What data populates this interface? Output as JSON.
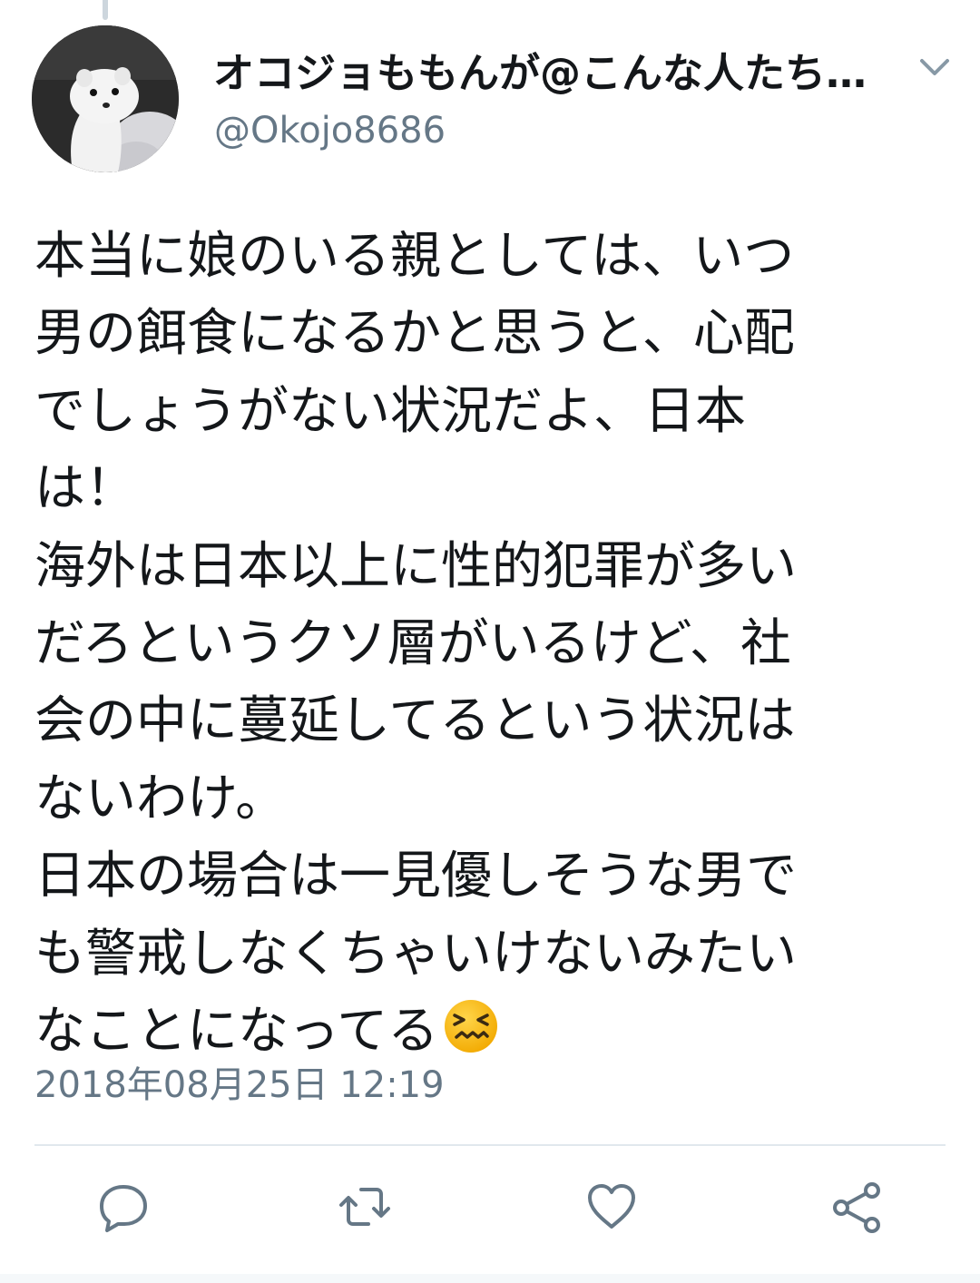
{
  "tweet": {
    "display_name": "オコジョももんが@こんな人たち…",
    "handle": "@Okojo8686",
    "text_lines": [
      "本当に娘のいる親としては、いつ",
      "男の餌食になるかと思うと、心配",
      "でしょうがない状況だよ、日本",
      "は！",
      "海外は日本以上に性的犯罪が多い",
      "だろというクソ層がいるけど、社",
      "会の中に蔓延してるという状況は",
      "ないわけ。",
      "日本の場合は一見優しそうな男で",
      "も警戒しなくちゃいけないみたい",
      "なことになってる"
    ],
    "emoji": "confounded-face",
    "timestamp": "2018年08月25日 12:19"
  },
  "icons": {
    "caret": "chevron-down-icon",
    "reply": "reply-icon",
    "retweet": "retweet-icon",
    "like": "heart-icon",
    "share": "share-icon"
  },
  "colors": {
    "text": "#14171a",
    "secondary": "#657786",
    "divider": "#e1e8ed",
    "icon": "#657786",
    "emoji": "#f4b400"
  }
}
